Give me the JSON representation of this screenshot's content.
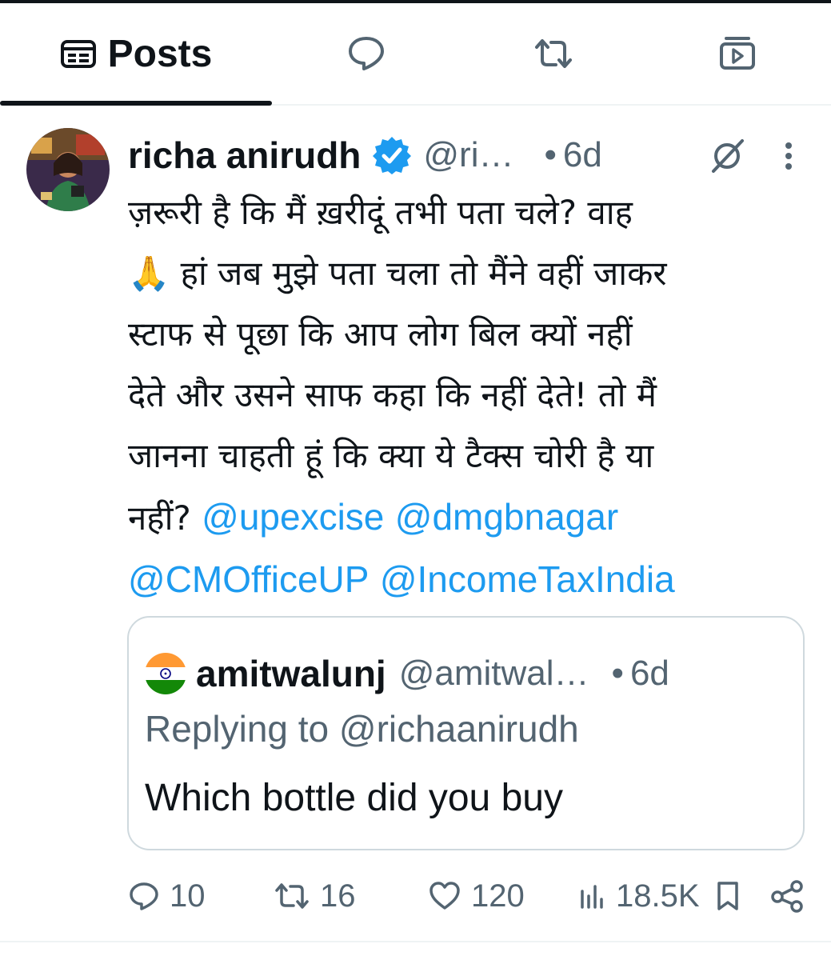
{
  "tabs": {
    "posts_label": "Posts",
    "items": [
      {
        "id": "posts",
        "icon": "posts-list-icon",
        "active": true
      },
      {
        "id": "replies",
        "icon": "reply-bubble-icon",
        "active": false
      },
      {
        "id": "reposts",
        "icon": "repost-icon",
        "active": false
      },
      {
        "id": "media",
        "icon": "video-icon",
        "active": false
      }
    ]
  },
  "post": {
    "author": {
      "display_name": "richa anirudh",
      "handle": "@ri…",
      "verified": true
    },
    "separator": "•",
    "time_ago": "6d",
    "text_lines": [
      "ज़रूरी है कि मैं ख़रीदूं तभी पता चले? वाह",
      "🙏 हां जब मुझे पता चला तो मैंने वहीं जाकर",
      "स्टाफ से पूछा कि आप लोग बिल क्यों नहीं",
      "देते और उसने साफ कहा कि नहीं देते! तो मैं",
      "जानना चाहती हूं कि क्या ये टैक्स चोरी है या"
    ],
    "last_line_text": "नहीं? ",
    "mentions": [
      "@upexcise",
      "@dmgbnagar",
      "@CMOfficeUP",
      "@IncomeTaxIndia"
    ],
    "quote": {
      "display_name": "amitwalunj",
      "handle": "@amitwal…",
      "separator": "•",
      "time_ago": "6d",
      "replying_to": "Replying to @richaanirudh",
      "text": "Which bottle did you buy"
    },
    "stats": {
      "replies": "10",
      "reposts": "16",
      "likes": "120",
      "views": "18.5K"
    }
  },
  "colors": {
    "accent": "#1d9bf0",
    "text_primary": "#0f1419",
    "text_secondary": "#536471",
    "border": "#cfd9de"
  }
}
